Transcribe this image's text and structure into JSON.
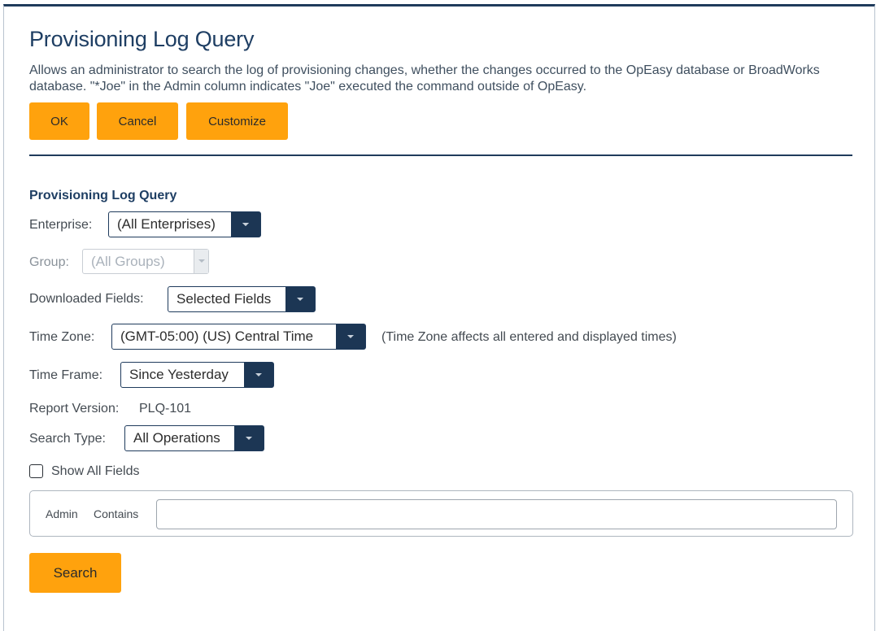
{
  "header": {
    "title": "Provisioning Log Query",
    "description": "Allows an administrator to search the log of provisioning changes, whether the changes occurred to the OpEasy database or BroadWorks database. \"*Joe\" in the Admin column indicates \"Joe\" executed the command outside of OpEasy."
  },
  "toolbar": {
    "ok_label": "OK",
    "cancel_label": "Cancel",
    "customize_label": "Customize"
  },
  "form": {
    "section_title": "Provisioning Log Query",
    "enterprise": {
      "label": "Enterprise:",
      "value": "(All Enterprises)"
    },
    "group": {
      "label": "Group:",
      "value": "(All Groups)"
    },
    "downloaded_fields": {
      "label": "Downloaded Fields:",
      "value": "Selected Fields"
    },
    "time_zone": {
      "label": "Time Zone:",
      "value": "(GMT-05:00) (US) Central Time",
      "note": "(Time Zone affects all entered and displayed times)"
    },
    "time_frame": {
      "label": "Time Frame:",
      "value": "Since Yesterday"
    },
    "report_version": {
      "label": "Report Version:",
      "value": "PLQ-101"
    },
    "search_type": {
      "label": "Search Type:",
      "value": "All Operations"
    },
    "show_all_fields": {
      "label": "Show All Fields",
      "checked": false
    },
    "filter": {
      "field": "Admin",
      "operator": "Contains",
      "value": "",
      "placeholder": ""
    },
    "search_label": "Search"
  },
  "colors": {
    "accent": "#ffa20d",
    "navy": "#1f3b5c",
    "title": "#1e3e63"
  },
  "icons": {
    "dropdown": "chevron-down-icon"
  }
}
